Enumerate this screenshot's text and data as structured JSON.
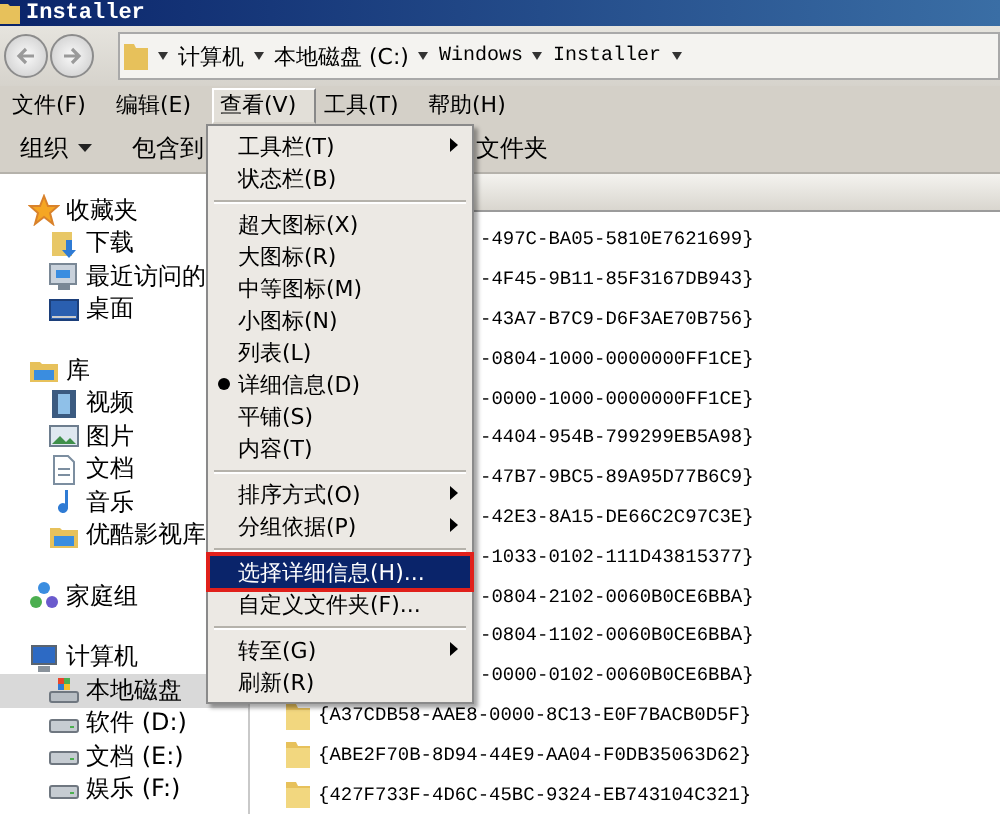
{
  "window": {
    "title": "Installer"
  },
  "address_bar": {
    "segments": [
      "计算机",
      "本地磁盘 (C:)",
      "Windows",
      "Installer"
    ]
  },
  "menu_bar": [
    {
      "label": "文件(F)",
      "selected": false
    },
    {
      "label": "编辑(E)",
      "selected": false
    },
    {
      "label": "查看(V)",
      "selected": true
    },
    {
      "label": "工具(T)",
      "selected": false
    },
    {
      "label": "帮助(H)",
      "selected": false
    }
  ],
  "toolbar": [
    {
      "label": "组织",
      "has_dropdown": true
    },
    {
      "label": "包含到",
      "has_dropdown": false
    },
    {
      "label": "文件夹",
      "has_dropdown": false
    }
  ],
  "sidebar": [
    {
      "label": "收藏夹",
      "kind": "star",
      "selected": false,
      "children": [
        {
          "label": "下载",
          "kind": "download",
          "selected": false
        },
        {
          "label": "最近访问的",
          "kind": "recent",
          "selected": false
        },
        {
          "label": "桌面",
          "kind": "desktop",
          "selected": false
        }
      ]
    },
    {
      "label": "库",
      "kind": "library",
      "selected": false,
      "children": [
        {
          "label": "视频",
          "kind": "video",
          "selected": false
        },
        {
          "label": "图片",
          "kind": "image",
          "selected": false
        },
        {
          "label": "文档",
          "kind": "document",
          "selected": false
        },
        {
          "label": "音乐",
          "kind": "music",
          "selected": false
        },
        {
          "label": "优酷影视库",
          "kind": "library",
          "selected": false
        }
      ]
    },
    {
      "label": "家庭组",
      "kind": "homegroup",
      "selected": false
    },
    {
      "label": "计算机",
      "kind": "computer",
      "selected": false,
      "children": [
        {
          "label": "本地磁盘",
          "kind": "systemdrive",
          "selected": true
        },
        {
          "label": "软件 (D:)",
          "kind": "drive",
          "selected": false
        },
        {
          "label": "文档 (E:)",
          "kind": "drive",
          "selected": false
        },
        {
          "label": "娱乐 (F:)",
          "kind": "drive",
          "selected": false
        }
      ]
    }
  ],
  "files": [
    {
      "kind": "partial",
      "name": "-497C-BA05-5810E7621699}"
    },
    {
      "kind": "partial",
      "name": "-4F45-9B11-85F3167DB943}"
    },
    {
      "kind": "partial",
      "name": "-43A7-B7C9-D6F3AE70B756}"
    },
    {
      "kind": "partial",
      "name": "-0804-1000-0000000FF1CE}"
    },
    {
      "kind": "partial",
      "name": "-0000-1000-0000000FF1CE}"
    },
    {
      "kind": "partial",
      "name": "-4404-954B-799299EB5A98}"
    },
    {
      "kind": "partial",
      "name": "-47B7-9BC5-89A95D77B6C9}"
    },
    {
      "kind": "partial",
      "name": "-42E3-8A15-DE66C2C97C3E}"
    },
    {
      "kind": "partial",
      "name": "-1033-0102-111D43815377}"
    },
    {
      "kind": "partial",
      "name": "-0804-2102-0060B0CE6BBA}"
    },
    {
      "kind": "partial",
      "name": "-0804-1102-0060B0CE6BBA}"
    },
    {
      "kind": "partial",
      "name": "-0000-0102-0060B0CE6BBA}"
    },
    {
      "kind": "full",
      "name": "{A37CDB58-AAE8-0000-8C13-E0F7BACB0D5F}"
    },
    {
      "kind": "full",
      "name": "{ABE2F70B-8D94-44E9-AA04-F0DB35063D62}"
    },
    {
      "kind": "full",
      "name": "{427F733F-4D6C-45BC-9324-EB743104C321}"
    }
  ],
  "view_menu": [
    {
      "kind": "item",
      "label": "工具栏(T)",
      "has_submenu": true,
      "checked": false,
      "selected": false
    },
    {
      "kind": "item",
      "label": "状态栏(B)",
      "has_submenu": false,
      "checked": false,
      "selected": false
    },
    {
      "kind": "separator"
    },
    {
      "kind": "item",
      "label": "超大图标(X)",
      "has_submenu": false,
      "checked": false,
      "selected": false
    },
    {
      "kind": "item",
      "label": "大图标(R)",
      "has_submenu": false,
      "checked": false,
      "selected": false
    },
    {
      "kind": "item",
      "label": "中等图标(M)",
      "has_submenu": false,
      "checked": false,
      "selected": false
    },
    {
      "kind": "item",
      "label": "小图标(N)",
      "has_submenu": false,
      "checked": false,
      "selected": false
    },
    {
      "kind": "item",
      "label": "列表(L)",
      "has_submenu": false,
      "checked": false,
      "selected": false
    },
    {
      "kind": "item",
      "label": "详细信息(D)",
      "has_submenu": false,
      "checked": true,
      "selected": false
    },
    {
      "kind": "item",
      "label": "平铺(S)",
      "has_submenu": false,
      "checked": false,
      "selected": false
    },
    {
      "kind": "item",
      "label": "内容(T)",
      "has_submenu": false,
      "checked": false,
      "selected": false
    },
    {
      "kind": "separator"
    },
    {
      "kind": "item",
      "label": "排序方式(O)",
      "has_submenu": true,
      "checked": false,
      "selected": false
    },
    {
      "kind": "item",
      "label": "分组依据(P)",
      "has_submenu": true,
      "checked": false,
      "selected": false
    },
    {
      "kind": "separator"
    },
    {
      "kind": "item",
      "label": "选择详细信息(H)...",
      "has_submenu": false,
      "checked": false,
      "selected": true
    },
    {
      "kind": "item",
      "label": "自定义文件夹(F)...",
      "has_submenu": false,
      "checked": false,
      "selected": false
    },
    {
      "kind": "separator"
    },
    {
      "kind": "item",
      "label": "转至(G)",
      "has_submenu": true,
      "checked": false,
      "selected": false
    },
    {
      "kind": "item",
      "label": "刷新(R)",
      "has_submenu": false,
      "checked": false,
      "selected": false
    }
  ]
}
